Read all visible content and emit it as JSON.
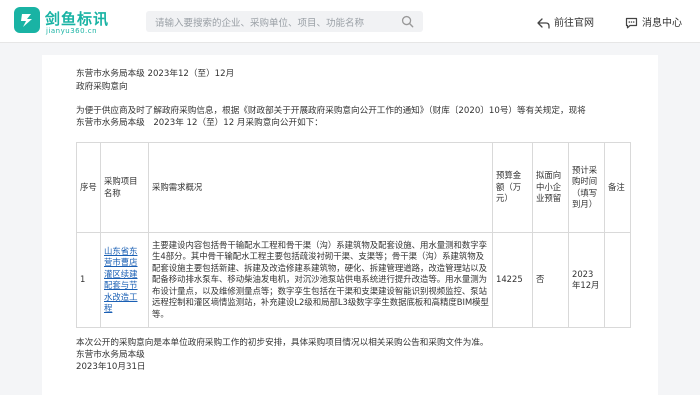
{
  "brand": {
    "name": "剑鱼标讯",
    "sub": "jianyu360.cn",
    "color": "#19b3a4"
  },
  "search": {
    "placeholder": "请输入要搜索的企业、采购单位、项目、功能名称"
  },
  "nav": {
    "prev_label": "前往官网",
    "msg_label": "消息中心"
  },
  "doc": {
    "line1": "东营市水务局本级 2023年12（至）12月",
    "line2": "政府采购意向",
    "intro1": "为便于供应商及时了解政府采购信息，根据《财政部关于开展政府采购意向公开工作的通知》（财库〔2020〕10号）等有关规定，现将",
    "intro2": "东营市水务局本级　2023年 12（至）12 月采购意向公开如下：",
    "footer1": "本次公开的采购意向是本单位政府采购工作的初步安排，具体采购项目情况以相关采购公告和采购文件为准。",
    "footer2": "东营市水务局本级",
    "footer3": "2023年10月31日"
  },
  "table": {
    "headers": {
      "seq": "序号",
      "name": "采购项目名称",
      "desc": "采购需求概况",
      "budget": "预算金额（万元）",
      "sme": "拟面向中小企业预留",
      "time": "预计采购时间（填写到月）",
      "note": "备注"
    },
    "rows": [
      {
        "seq": "1",
        "name": "山东省东营市曹店灌区续建配套与节水改造工程",
        "desc": "主要建设内容包括骨干输配水工程和骨干渠（沟）系建筑物及配套设施、用水量测和数字孪生4部分。其中骨干输配水工程主要包括疏浚衬砌干渠、支渠等；骨干渠（沟）系建筑物及配套设施主要包括新建、拆建及改造修建系建筑物，硬化、拆建管理道路，改造管理站以及配备移动排水泵车、移动柴油发电机，对沉沙池泵站供电系统进行提升改造等。用水量测为布设计量点，以及维修测量点等；数字孪生包括在干渠和支渠建设智能识别视频监控、泵站远程控制和灌区墒情监测站，补充建设L2级和局部L3级数字孪生数据底板和高精度BIM模型等。",
        "budget": "14225",
        "sme": "否",
        "time": "2023年12月",
        "note": ""
      }
    ]
  }
}
